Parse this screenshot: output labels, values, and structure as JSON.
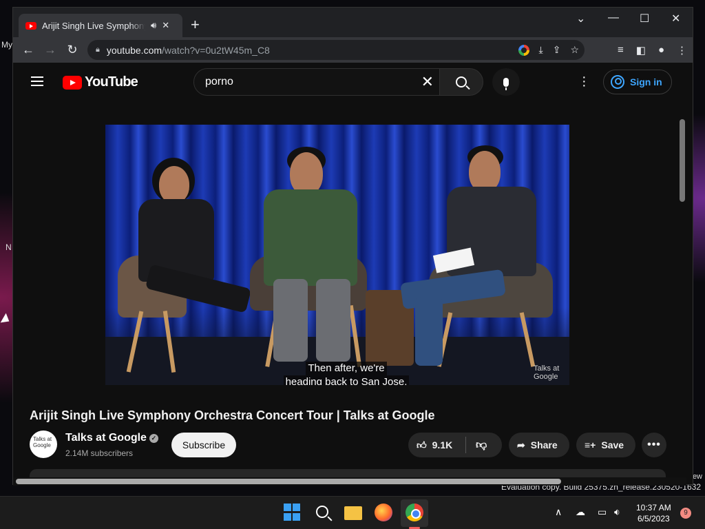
{
  "desktop": {
    "labels": [
      "My",
      "N"
    ],
    "build_text": "Evaluation copy. Build 25375.zn_release.230520-1632",
    "new_text": "ew"
  },
  "browser": {
    "tab_title": "Arijit Singh Live Symphony Orchestra Concert Tour | Talks at Google - YouTube",
    "url_host": "youtube.com",
    "url_path": "/watch?v=0u2tW45m_C8"
  },
  "youtube": {
    "logo_text": "YouTube",
    "search_value": "porno",
    "sign_in_label": "Sign in",
    "caption_lines": [
      "Then after, we're",
      "heading back to San Jose."
    ],
    "watermark": "Talks at Google",
    "video_title": "Arijit Singh Live Symphony Orchestra Concert Tour | Talks at Google",
    "channel_name": "Talks at Google",
    "avatar_text": "Talks at Google",
    "subscribers": "2.14M subscribers",
    "subscribe_label": "Subscribe",
    "likes": "9.1K",
    "share_label": "Share",
    "save_label": "Save"
  },
  "taskbar": {
    "time": "10:37 AM",
    "date": "6/5/2023",
    "notification_count": "9"
  },
  "colors": {
    "accent_blue": "#3ea6ff",
    "yt_red": "#ff0000",
    "page_bg": "#0f0f0f"
  }
}
